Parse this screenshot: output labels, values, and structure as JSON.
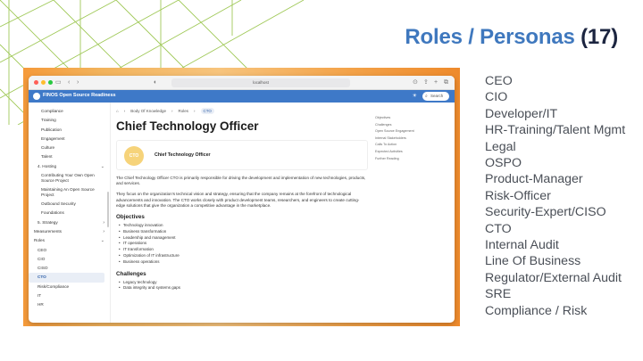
{
  "slide": {
    "title": "Roles / Personas",
    "count": "(17)",
    "personas": [
      "CEO",
      "CIO",
      "Developer/IT",
      "HR-Training/Talent Mgmt",
      "Legal",
      "OSPO",
      "Product-Manager",
      "Risk-Officer",
      "Security-Expert/CISO",
      "CTO",
      "Internal Audit",
      "Line Of Business",
      "Regulator/External Audit",
      "SRE",
      "Compliance / Risk"
    ]
  },
  "colors": {
    "title_blue": "#3f78be",
    "count_dark": "#1c2540",
    "header_blue": "#3e79c8",
    "deco_green": "#8fbf3a"
  },
  "browser": {
    "url": "localhost",
    "back_icon": "chevron-left-icon",
    "forward_icon": "chevron-right-icon"
  },
  "site": {
    "title": "FINOS Open Source Readiness",
    "search_placeholder": "Search",
    "search_shortcut": "⌘K"
  },
  "sidebar": {
    "items": [
      {
        "label": "Compliance",
        "indent": 2
      },
      {
        "label": "Training",
        "indent": 2
      },
      {
        "label": "Publication",
        "indent": 2
      },
      {
        "label": "Engagement",
        "indent": 2
      },
      {
        "label": "Culture",
        "indent": 2
      },
      {
        "label": "Talent",
        "indent": 2
      },
      {
        "label": "4. Hosting",
        "indent": 1,
        "chevron": "⌄"
      },
      {
        "label": "Contributing Your Own Open Source Project",
        "indent": 2,
        "wrap": true
      },
      {
        "label": "Maintaining An Open Source Project",
        "indent": 2,
        "wrap": true
      },
      {
        "label": "Outbound Security",
        "indent": 2
      },
      {
        "label": "Foundations",
        "indent": 2
      },
      {
        "label": "5. Strategy",
        "indent": 1,
        "chevron": "›"
      },
      {
        "label": "Measurements",
        "indent": 0,
        "chevron": "›"
      },
      {
        "label": "Roles",
        "indent": 0,
        "chevron": "⌄"
      },
      {
        "label": "CEO",
        "indent": 1
      },
      {
        "label": "CIO",
        "indent": 1
      },
      {
        "label": "CISO",
        "indent": 1
      },
      {
        "label": "CTO",
        "indent": 1,
        "active": true
      },
      {
        "label": "Risk/Compliance",
        "indent": 1
      },
      {
        "label": "IT",
        "indent": 1
      },
      {
        "label": "HR",
        "indent": 1
      }
    ]
  },
  "breadcrumb": [
    "Body Of Knowledge",
    "Roles",
    "CTO"
  ],
  "page": {
    "title": "Chief Technology Officer",
    "badge": "CTO",
    "card_name": "Chief Technology Officer",
    "para1": "The Chief Technology Officer CTO is primarily responsible for driving the development and implementation of new technologies, products, and services.",
    "para2": "They focus on the organization's technical vision and strategy, ensuring that the company remains at the forefront of technological advancements and innovation. The CTO works closely with product development teams, researchers, and engineers to create cutting-edge solutions that give the organization a competitive advantage in the marketplace.",
    "objectives_heading": "Objectives",
    "objectives": [
      "Technology innovation",
      "Business transformation",
      "Leadership and management",
      "IT operations",
      "IT transformation",
      "Optimization of IT infrastructure",
      "Business operations"
    ],
    "challenges_heading": "Challenges",
    "challenges": [
      "Legacy technology",
      "Data integrity and systems gaps"
    ]
  },
  "toc": [
    "Objectives",
    "Challenges",
    "Open Source Engagement",
    "Internal Stakeholders",
    "Calls To Action",
    "Expected Activities",
    "Further Reading"
  ]
}
